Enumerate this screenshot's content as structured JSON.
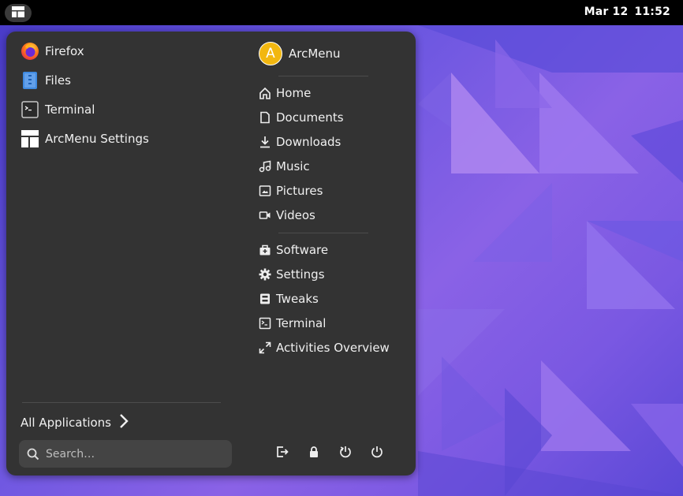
{
  "topbar": {
    "date": "Mar 12",
    "time": "11:52",
    "activities_icon": "arcmenu-layout-icon"
  },
  "menu": {
    "favorites": [
      {
        "label": "Firefox",
        "icon": "firefox-icon"
      },
      {
        "label": "Files",
        "icon": "files-icon"
      },
      {
        "label": "Terminal",
        "icon": "terminal-icon"
      },
      {
        "label": "ArcMenu Settings",
        "icon": "arcmenu-settings-icon"
      }
    ],
    "user": {
      "avatar_letter": "A",
      "name": "ArcMenu",
      "avatar_color": "#f2b710"
    },
    "places": [
      {
        "label": "Home",
        "icon": "home-icon"
      },
      {
        "label": "Documents",
        "icon": "document-icon"
      },
      {
        "label": "Downloads",
        "icon": "download-icon"
      },
      {
        "label": "Music",
        "icon": "music-icon"
      },
      {
        "label": "Pictures",
        "icon": "picture-icon"
      },
      {
        "label": "Videos",
        "icon": "video-icon"
      }
    ],
    "system": [
      {
        "label": "Software",
        "icon": "software-icon"
      },
      {
        "label": "Settings",
        "icon": "gear-icon"
      },
      {
        "label": "Tweaks",
        "icon": "tweaks-icon"
      },
      {
        "label": "Terminal",
        "icon": "terminal-small-icon"
      },
      {
        "label": "Activities Overview",
        "icon": "expand-icon"
      }
    ],
    "all_applications": "All Applications",
    "search_placeholder": "Search…",
    "power_buttons": [
      "log-out-icon",
      "lock-icon",
      "restart-icon",
      "power-off-icon"
    ]
  },
  "colors": {
    "panel": "#333333",
    "accent": "#f2b710",
    "wallpaper": "#6a56e0"
  }
}
